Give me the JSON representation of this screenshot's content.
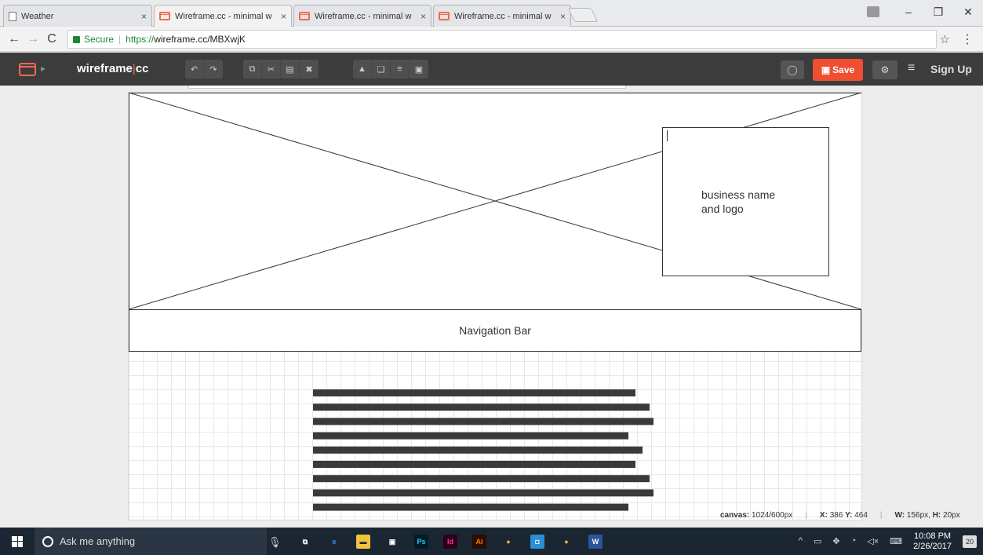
{
  "browser": {
    "tabs": [
      {
        "title": "Weather",
        "favicon": "page-icon",
        "active": false
      },
      {
        "title": "Wireframe.cc - minimal w",
        "favicon": "wireframe-icon",
        "active": true
      },
      {
        "title": "Wireframe.cc - minimal w",
        "favicon": "wireframe-icon",
        "active": false
      },
      {
        "title": "Wireframe.cc - minimal w",
        "favicon": "wireframe-icon",
        "active": false
      }
    ],
    "tab_close": "×",
    "window_controls": {
      "minimize": "–",
      "restore": "❐",
      "close": "✕"
    },
    "nav": {
      "back": "←",
      "forward": "→",
      "reload": "C"
    },
    "secure_label": "Secure",
    "url_scheme": "https://",
    "url_rest": "wireframe.cc/MBXwjK",
    "star": "☆",
    "menu": "⋮"
  },
  "app": {
    "brand_name": "wireframe",
    "brand_suffix": "cc",
    "brand_separator": "|",
    "toolbar_groups": [
      [
        {
          "name": "undo-button",
          "glyph": "↶"
        },
        {
          "name": "redo-button",
          "glyph": "↷"
        }
      ],
      [
        {
          "name": "copy-button",
          "glyph": "⧉"
        },
        {
          "name": "cut-button",
          "glyph": "✂"
        },
        {
          "name": "paste-button",
          "glyph": "▤"
        },
        {
          "name": "delete-button",
          "glyph": "✖"
        }
      ],
      [
        {
          "name": "lock-button",
          "glyph": "▲"
        },
        {
          "name": "bring-front-button",
          "glyph": "❏"
        },
        {
          "name": "align-button",
          "glyph": "≡"
        },
        {
          "name": "group-button",
          "glyph": "▣"
        }
      ]
    ],
    "comment_glyph": "◯",
    "save_label": "Save",
    "save_glyph": "▣",
    "settings_glyph": "⚙",
    "menu_glyph": "≡",
    "signup_label": "Sign Up",
    "accent_color": "#f04e31"
  },
  "canvas": {
    "logo_box_text": "business name\nand logo",
    "navbar_label": "Navigation Bar",
    "text_block_line_lengths": [
      0.91,
      0.95,
      0.96,
      0.89,
      0.93,
      0.91,
      0.95,
      0.96,
      0.89
    ]
  },
  "status": {
    "canvas_label": "canvas:",
    "canvas_value": "1024/600px",
    "x_label": "X:",
    "x_value": "386",
    "y_label": "Y:",
    "y_value": "464",
    "w_label": "W:",
    "w_value": "156px",
    "h_label": "H:",
    "h_value": "20px"
  },
  "taskbar": {
    "search_placeholder": "Ask me anything",
    "apps": [
      {
        "name": "task-view-icon",
        "glyph": "⧉",
        "bg": "transparent",
        "fg": "#ffffff"
      },
      {
        "name": "edge-icon",
        "glyph": "e",
        "bg": "transparent",
        "fg": "#3c8ce7"
      },
      {
        "name": "file-explorer-icon",
        "glyph": "▬",
        "bg": "#f4c33d",
        "fg": "#1b2633"
      },
      {
        "name": "store-icon",
        "glyph": "▣",
        "bg": "transparent",
        "fg": "#ffffff"
      },
      {
        "name": "photoshop-icon",
        "glyph": "Ps",
        "bg": "#001d26",
        "fg": "#31c5f0"
      },
      {
        "name": "indesign-icon",
        "glyph": "Id",
        "bg": "#2e0017",
        "fg": "#ff3399"
      },
      {
        "name": "illustrator-icon",
        "glyph": "Ai",
        "bg": "#2a0c00",
        "fg": "#ff7c00"
      },
      {
        "name": "chrome-icon",
        "glyph": "●",
        "bg": "transparent",
        "fg": "#e9b12b"
      },
      {
        "name": "app-icon",
        "glyph": "◘",
        "bg": "#2a8fd6",
        "fg": "#ffffff"
      },
      {
        "name": "chrome-canary-icon",
        "glyph": "●",
        "bg": "transparent",
        "fg": "#e9b12b"
      },
      {
        "name": "word-icon",
        "glyph": "W",
        "bg": "#2b579a",
        "fg": "#ffffff"
      }
    ],
    "tray_glyphs": [
      "^",
      "▭",
      "✥",
      "◔",
      "◁×",
      "⌨"
    ],
    "time": "10:08 PM",
    "date": "2/26/2017",
    "notification_count": "20"
  }
}
